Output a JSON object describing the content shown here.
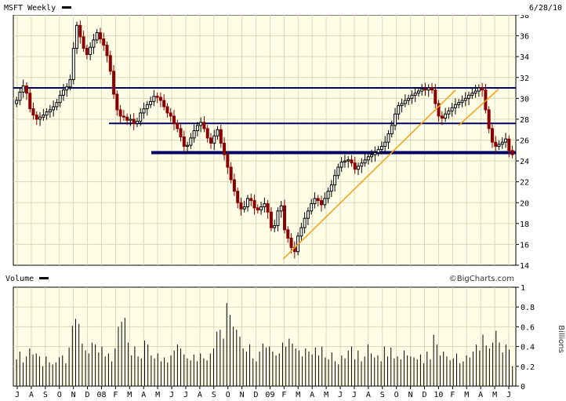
{
  "header": {
    "symbol_label": "MSFT Weekly",
    "date": "6/28/10"
  },
  "volume_label": "Volume",
  "credit": "©BigCharts.com",
  "colors": {
    "background": "#ffffe8",
    "grid": "#d8d8b8",
    "up": "#000000",
    "down": "#8b0000",
    "support": "#000066",
    "trend": "#f5a015",
    "volume_bar": "#000000"
  },
  "chart_data": [
    {
      "type": "candlestick",
      "title": "MSFT Weekly",
      "ylim": [
        14,
        38
      ],
      "y_ticks": [
        14,
        16,
        18,
        20,
        22,
        24,
        26,
        28,
        30,
        32,
        34,
        36,
        38
      ],
      "x_tick_labels": [
        "J",
        "A",
        "S",
        "O",
        "N",
        "D",
        "08",
        "F",
        "M",
        "A",
        "M",
        "J",
        "J",
        "A",
        "S",
        "O",
        "N",
        "D",
        "09",
        "F",
        "M",
        "A",
        "M",
        "J",
        "J",
        "A",
        "S",
        "O",
        "N",
        "D",
        "10",
        "F",
        "M",
        "A",
        "M",
        "J"
      ],
      "grid": true,
      "close_series": [
        29.8,
        30.6,
        31.2,
        30.5,
        29.0,
        28.4,
        28.0,
        28.2,
        28.4,
        28.7,
        28.9,
        29.2,
        29.6,
        30.3,
        30.8,
        31.1,
        31.8,
        34.8,
        37.0,
        35.9,
        34.8,
        34.2,
        34.9,
        35.6,
        36.3,
        35.7,
        35.1,
        34.1,
        32.6,
        30.4,
        28.9,
        28.3,
        28.2,
        27.9,
        28.0,
        27.6,
        27.8,
        28.6,
        29.0,
        29.4,
        29.7,
        30.2,
        30.1,
        29.8,
        29.2,
        28.6,
        28.3,
        27.6,
        27.1,
        26.3,
        25.4,
        25.5,
        26.2,
        26.9,
        27.4,
        27.7,
        27.1,
        26.2,
        25.7,
        26.4,
        27.0,
        25.7,
        24.6,
        23.4,
        22.2,
        21.1,
        20.0,
        19.4,
        19.6,
        20.4,
        20.2,
        19.5,
        19.3,
        19.6,
        19.9,
        19.1,
        17.6,
        17.8,
        19.2,
        19.7,
        17.4,
        16.6,
        15.7,
        15.3,
        16.8,
        17.6,
        18.5,
        19.2,
        19.9,
        20.4,
        20.2,
        19.8,
        20.4,
        21.1,
        21.7,
        22.6,
        23.4,
        23.9,
        24.0,
        24.1,
        23.8,
        23.2,
        23.5,
        23.8,
        24.1,
        24.4,
        24.6,
        24.8,
        25.1,
        25.4,
        25.8,
        26.6,
        27.4,
        28.5,
        29.3,
        29.5,
        29.8,
        30.0,
        30.3,
        30.5,
        30.7,
        30.9,
        30.8,
        31.0,
        30.8,
        29.5,
        28.3,
        28.1,
        28.5,
        28.8,
        29.1,
        29.4,
        29.6,
        29.8,
        30.0,
        30.3,
        30.5,
        30.7,
        31.0,
        30.8,
        28.9,
        27.1,
        25.8,
        25.4,
        25.6,
        25.8,
        26.1,
        25.0,
        24.6
      ],
      "support_levels": [
        31.0,
        27.6,
        24.8
      ],
      "trendlines": [
        {
          "from": [
            0.537,
            14.6
          ],
          "to": [
            0.88,
            30.8
          ]
        },
        {
          "from": [
            0.886,
            27.4
          ],
          "to": [
            0.966,
            30.9
          ]
        }
      ]
    },
    {
      "type": "bar",
      "title": "Volume",
      "ylabel": "Billions",
      "ylim": [
        0,
        1
      ],
      "y_ticks": [
        0,
        0.2,
        0.4,
        0.6,
        0.8,
        1
      ],
      "grid": true,
      "values": [
        0.27,
        0.35,
        0.24,
        0.3,
        0.38,
        0.32,
        0.33,
        0.3,
        0.2,
        0.3,
        0.24,
        0.22,
        0.24,
        0.29,
        0.31,
        0.23,
        0.39,
        0.61,
        0.68,
        0.63,
        0.43,
        0.36,
        0.33,
        0.44,
        0.42,
        0.34,
        0.4,
        0.3,
        0.33,
        0.25,
        0.38,
        0.6,
        0.65,
        0.69,
        0.44,
        0.31,
        0.4,
        0.3,
        0.28,
        0.46,
        0.42,
        0.31,
        0.28,
        0.33,
        0.25,
        0.29,
        0.24,
        0.31,
        0.36,
        0.42,
        0.38,
        0.32,
        0.28,
        0.26,
        0.32,
        0.25,
        0.33,
        0.28,
        0.26,
        0.33,
        0.38,
        0.55,
        0.57,
        0.48,
        0.84,
        0.72,
        0.6,
        0.57,
        0.5,
        0.38,
        0.35,
        0.42,
        0.28,
        0.25,
        0.35,
        0.43,
        0.39,
        0.4,
        0.35,
        0.31,
        0.33,
        0.44,
        0.4,
        0.48,
        0.43,
        0.38,
        0.36,
        0.3,
        0.38,
        0.35,
        0.32,
        0.39,
        0.31,
        0.4,
        0.29,
        0.27,
        0.34,
        0.25,
        0.22,
        0.31,
        0.28,
        0.36,
        0.4,
        0.27,
        0.36,
        0.25,
        0.3,
        0.42,
        0.33,
        0.29,
        0.31,
        0.25,
        0.4,
        0.3,
        0.39,
        0.28,
        0.3,
        0.27,
        0.36,
        0.31,
        0.3,
        0.29,
        0.27,
        0.32,
        0.23,
        0.35,
        0.27,
        0.52,
        0.42,
        0.31,
        0.35,
        0.3,
        0.26,
        0.28,
        0.33,
        0.23,
        0.25,
        0.31,
        0.29,
        0.35,
        0.42,
        0.36,
        0.52,
        0.41,
        0.38,
        0.44,
        0.56,
        0.44,
        0.34,
        0.42,
        0.37,
        0.2
      ]
    }
  ]
}
